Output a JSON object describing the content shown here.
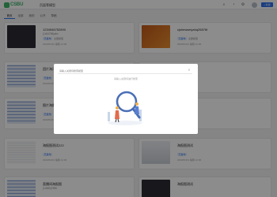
{
  "header": {
    "logo_text": "CSBU",
    "app_title": "页面等模型",
    "create_label": "+ 新建"
  },
  "tabs": [
    "首页",
    "全部",
    "我的",
    "公开",
    "草稿"
  ],
  "cards": [
    {
      "title": "1234546752890",
      "sub": "(1x54796)abc",
      "tag": "已发布",
      "tag2": "全部模型",
      "meta": "2023/01/01 编辑 12:00"
    },
    {
      "title": "cjshewseiyahq26876t",
      "sub": "",
      "tag": "已发布",
      "tag2": "全部模型",
      "meta": "2023/01/01 编辑 12:00"
    },
    {
      "title": "团片海洋",
      "sub": "",
      "tag": "已发布",
      "tag2": "",
      "meta": "2023/01/01 编辑"
    },
    {
      "title": "海报测试",
      "sub": "",
      "tag": "已发布",
      "tag2": "",
      "meta": "2023/01/01 编辑"
    },
    {
      "title": "图片海报",
      "sub": "",
      "tag": "已发布",
      "tag2": "",
      "meta": "2023/01/01 编辑"
    },
    {
      "title": "测试",
      "sub": "",
      "tag": "已发布",
      "tag2": "",
      "meta": "2023/01/01 编辑"
    },
    {
      "title": "海报图测试222",
      "sub": "",
      "tag": "已发布",
      "tag2": "",
      "meta": "2023/01/01 编辑 12:00"
    },
    {
      "title": "海报图测试",
      "sub": "",
      "tag": "已发布",
      "tag2": "",
      "meta": "2023/01/01 编辑 12:00"
    },
    {
      "title": "直播间海报图",
      "sub": "(1x580)7896",
      "tag": "",
      "tag2": "",
      "meta": ""
    },
    {
      "title": "海报图测试",
      "sub": "",
      "tag": "",
      "tag2": "",
      "meta": ""
    }
  ],
  "modal": {
    "search_placeholder": "请输入关键词搜索模型",
    "hint": "请输入关键词进行搜索"
  }
}
